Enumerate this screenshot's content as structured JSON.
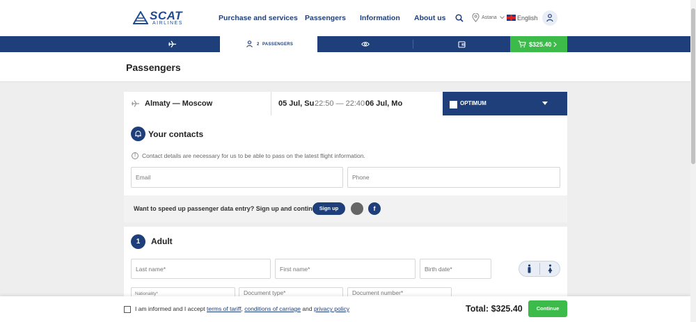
{
  "header": {
    "logo_main": "SCAT",
    "logo_sub": "AIRLINES",
    "nav": [
      "Purchase and services",
      "Passengers",
      "Information",
      "About us"
    ],
    "city": "Astana",
    "language": "English"
  },
  "steps": {
    "passengers_count": "2",
    "passengers_label": "PASSENGERS",
    "price": "$325.40"
  },
  "page_title": "Passengers",
  "route": {
    "cities": "Almaty — Moscow",
    "depart_date": "05 Jul, Su",
    "times": "22:50 — 22:40",
    "arrive_date": "06 Jul, Mo",
    "tariff": "OPTIMUM"
  },
  "contacts": {
    "title": "Your contacts",
    "info": "Contact details are necessary for us to be able to pass on the latest flight information.",
    "email_placeholder": "Email",
    "phone_placeholder": "Phone",
    "signup_prompt": "Want to speed up passenger data entry? Sign up and continue.",
    "signup_button": "Sign up",
    "facebook_letter": "f"
  },
  "adult": {
    "number": "1",
    "title": "Adult",
    "last_name_placeholder": "Last name*",
    "first_name_placeholder": "First name*",
    "birth_date_placeholder": "Birth date*",
    "nationality_label": "Nationality*",
    "document_type_placeholder": "Document type*",
    "document_number_placeholder": "Document number*"
  },
  "footer": {
    "agree_prefix": "I am informed and I accept",
    "link_tariff": "terms of tariff",
    "comma": ",",
    "link_carriage": "conditions of carriage",
    "and": "and",
    "link_privacy": "privacy policy",
    "total": "Total:  $325.40",
    "continue": "Continue"
  },
  "colors": {
    "primary": "#1f3f7a",
    "accent_green": "#3cbb4a",
    "background": "#eeeeee"
  }
}
